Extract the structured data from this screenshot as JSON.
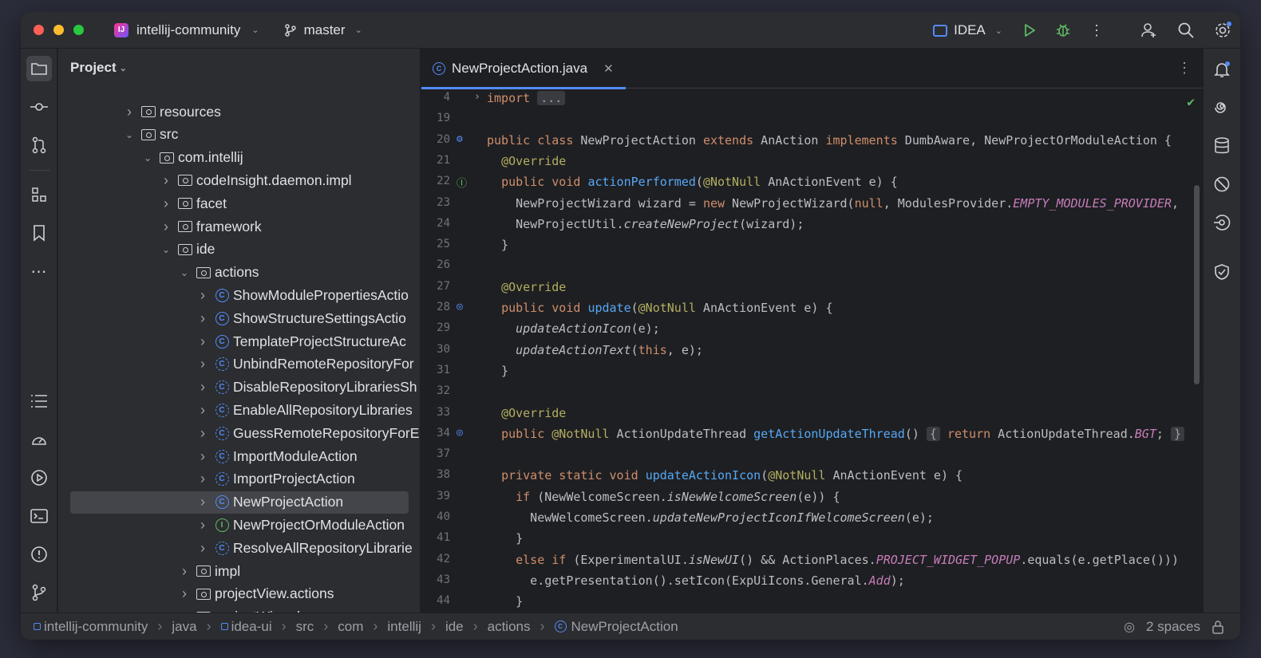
{
  "titlebar": {
    "project_name": "intellij-community",
    "project_badge": "IJ",
    "branch": "master",
    "run_config": "IDEA"
  },
  "project_panel": {
    "title": "Project",
    "tree": [
      {
        "label": "resources",
        "kind": "folder-res",
        "indent": 1,
        "expanded": false
      },
      {
        "label": "src",
        "kind": "folder-src",
        "indent": 1,
        "expanded": true
      },
      {
        "label": "com.intellij",
        "kind": "package",
        "indent": 2,
        "expanded": true
      },
      {
        "label": "codeInsight.daemon.impl",
        "kind": "package",
        "indent": 3,
        "expanded": false
      },
      {
        "label": "facet",
        "kind": "package",
        "indent": 3,
        "expanded": false
      },
      {
        "label": "framework",
        "kind": "package",
        "indent": 3,
        "expanded": false
      },
      {
        "label": "ide",
        "kind": "package",
        "indent": 3,
        "expanded": true
      },
      {
        "label": "actions",
        "kind": "package",
        "indent": 4,
        "expanded": true
      },
      {
        "label": "ShowModulePropertiesActio",
        "kind": "class",
        "indent": 5,
        "expanded": false
      },
      {
        "label": "ShowStructureSettingsActio",
        "kind": "class",
        "indent": 5,
        "expanded": false
      },
      {
        "label": "TemplateProjectStructureAc",
        "kind": "class",
        "indent": 5,
        "expanded": false
      },
      {
        "label": "UnbindRemoteRepositoryFor",
        "kind": "class-abs",
        "indent": 5,
        "expanded": false
      },
      {
        "label": "DisableRepositoryLibrariesSh",
        "kind": "class-abs",
        "indent": 5,
        "expanded": false
      },
      {
        "label": "EnableAllRepositoryLibraries",
        "kind": "class-abs",
        "indent": 5,
        "expanded": false
      },
      {
        "label": "GuessRemoteRepositoryForE",
        "kind": "class-abs",
        "indent": 5,
        "expanded": false
      },
      {
        "label": "ImportModuleAction",
        "kind": "class-abs",
        "indent": 5,
        "expanded": false
      },
      {
        "label": "ImportProjectAction",
        "kind": "class-abs",
        "indent": 5,
        "expanded": false
      },
      {
        "label": "NewProjectAction",
        "kind": "class",
        "indent": 5,
        "expanded": false,
        "selected": true
      },
      {
        "label": "NewProjectOrModuleAction",
        "kind": "interface",
        "indent": 5,
        "expanded": false
      },
      {
        "label": "ResolveAllRepositoryLibrarie",
        "kind": "class-abs",
        "indent": 5,
        "expanded": false
      },
      {
        "label": "impl",
        "kind": "package",
        "indent": 4,
        "expanded": false
      },
      {
        "label": "projectView.actions",
        "kind": "package",
        "indent": 4,
        "expanded": false
      },
      {
        "label": "projectWizard",
        "kind": "package",
        "indent": 4,
        "expanded": false
      }
    ]
  },
  "editor": {
    "tab_label": "NewProjectAction.java",
    "lines": [
      {
        "n": "4",
        "html": "<span class=\"kw\">import</span> <span class=\"fold-box\">...</span>"
      },
      {
        "n": "19",
        "html": ""
      },
      {
        "n": "20",
        "html": "<span class=\"kw\">public class</span> NewProjectAction <span class=\"kw\">extends</span> AnAction <span class=\"kw\">implements</span> DumbAware, NewProjectOrModuleAction {"
      },
      {
        "n": "21",
        "html": "  <span class=\"an\">@Override</span>"
      },
      {
        "n": "22",
        "html": "  <span class=\"kw\">public void</span> <span class=\"fn\">actionPerformed</span>(<span class=\"an\">@NotNull</span> AnActionEvent e) {"
      },
      {
        "n": "23",
        "html": "    NewProjectWizard wizard = <span class=\"kw\">new</span> NewProjectWizard(<span class=\"kw\">null</span>, ModulesProvider.<span class=\"st\">EMPTY_MODULES_PROVIDER</span>,"
      },
      {
        "n": "24",
        "html": "    NewProjectUtil.<span class=\"it\">createNewProject</span>(wizard);"
      },
      {
        "n": "25",
        "html": "  }"
      },
      {
        "n": "26",
        "html": ""
      },
      {
        "n": "27",
        "html": "  <span class=\"an\">@Override</span>"
      },
      {
        "n": "28",
        "html": "  <span class=\"kw\">public void</span> <span class=\"fn\">update</span>(<span class=\"an\">@NotNull</span> AnActionEvent e) {"
      },
      {
        "n": "29",
        "html": "    <span class=\"it\">updateActionIcon</span>(e);"
      },
      {
        "n": "30",
        "html": "    <span class=\"it\">updateActionText</span>(<span class=\"kw\">this</span>, e);"
      },
      {
        "n": "31",
        "html": "  }"
      },
      {
        "n": "32",
        "html": ""
      },
      {
        "n": "33",
        "html": "  <span class=\"an\">@Override</span>"
      },
      {
        "n": "34",
        "html": "  <span class=\"kw\">public</span> <span class=\"an\">@NotNull</span> ActionUpdateThread <span class=\"fn\">getActionUpdateThread</span>() <span class=\"fold-box\">{</span> <span class=\"kw\">return</span> ActionUpdateThread.<span class=\"st\">BGT</span>; <span class=\"fold-box\">}</span>"
      },
      {
        "n": "37",
        "html": ""
      },
      {
        "n": "38",
        "html": "  <span class=\"kw\">private static void</span> <span class=\"fn\">updateActionIcon</span>(<span class=\"an\">@NotNull</span> AnActionEvent e) {"
      },
      {
        "n": "39",
        "html": "    <span class=\"kw\">if</span> (NewWelcomeScreen.<span class=\"it\">isNewWelcomeScreen</span>(e)) {"
      },
      {
        "n": "40",
        "html": "      NewWelcomeScreen.<span class=\"it\">updateNewProjectIconIfWelcomeScreen</span>(e);"
      },
      {
        "n": "41",
        "html": "    }"
      },
      {
        "n": "42",
        "html": "    <span class=\"kw\">else if</span> (ExperimentalUI.<span class=\"it\">isNewUI</span>() &amp;&amp; ActionPlaces.<span class=\"st\">PROJECT_WIDGET_POPUP</span>.equals(e.getPlace()))"
      },
      {
        "n": "43",
        "html": "      e.getPresentation().setIcon(ExpUiIcons.General.<span class=\"st\">Add</span>);"
      },
      {
        "n": "44",
        "html": "    }"
      }
    ]
  },
  "statusbar": {
    "breadcrumbs": [
      "intellij-community",
      "java",
      "idea-ui",
      "src",
      "com",
      "intellij",
      "ide",
      "actions",
      "NewProjectAction"
    ],
    "indent": "2 spaces"
  },
  "colors": {
    "accent": "#548af7",
    "keyword": "#cf8e6d",
    "function": "#56a8f5",
    "annotation": "#b3ae60",
    "static_field": "#c77dbb"
  }
}
